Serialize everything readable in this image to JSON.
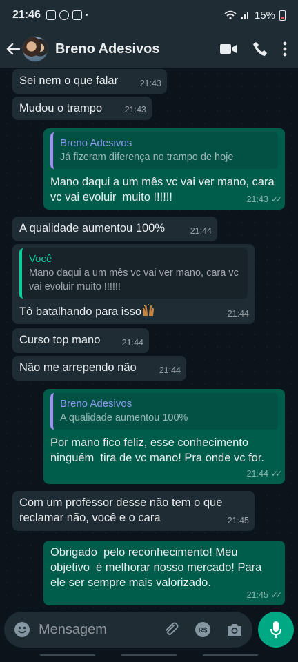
{
  "status": {
    "time": "21:46",
    "battery": "15%",
    "dot": "•"
  },
  "header": {
    "back_icon": "arrow-left-icon",
    "contact_name": "Breno Adesivos"
  },
  "messages": [
    {
      "dir": "in",
      "text": "Sei nem o que falar",
      "time": "21:43"
    },
    {
      "dir": "in",
      "text": "Mudou o trampo",
      "time": "21:43"
    },
    {
      "dir": "out",
      "quote_author": "Breno Adesivos",
      "quote_text": "Já fizeram diferença no trampo de hoje",
      "text": "Mano daqui a um mês vc vai ver mano, cara vc vai evoluir  muito !!!!!!",
      "time": "21:43",
      "status": "read"
    },
    {
      "dir": "in",
      "text": "A qualidade aumentou 100%",
      "time": "21:44"
    },
    {
      "dir": "in",
      "quote_author": "Você",
      "quote_text": "Mano daqui a um mês vc vai ver mano, cara vc vai evoluir  muito !!!!!!",
      "text": "Tô batalhando para isso",
      "time": "21:44",
      "emoji": "raised-hands-emoji"
    },
    {
      "dir": "in",
      "text": "Curso top mano",
      "time": "21:44"
    },
    {
      "dir": "in",
      "text": "Não me arrependo não",
      "time": "21:44"
    },
    {
      "dir": "out",
      "quote_author": "Breno Adesivos",
      "quote_text": "A qualidade aumentou 100%",
      "text": "Por mano fico feliz, esse conhecimento ninguém  tira de vc mano! Pra onde vc for.",
      "time": "21:44",
      "status": "read"
    },
    {
      "dir": "in",
      "text": "Com um professor desse não tem o que reclamar não, você e o cara",
      "time": "21:45"
    },
    {
      "dir": "out",
      "text": "Obrigado  pelo reconhecimento! Meu objetivo  é melhorar nosso mercado! Para ele ser sempre mais valorizado.",
      "time": "21:45",
      "status": "read"
    }
  ],
  "composer": {
    "placeholder": "Mensagem"
  },
  "colors": {
    "background": "#0b141a",
    "incoming_bubble": "#1f2c34",
    "outgoing_bubble": "#005c4b",
    "accent": "#00a884"
  }
}
